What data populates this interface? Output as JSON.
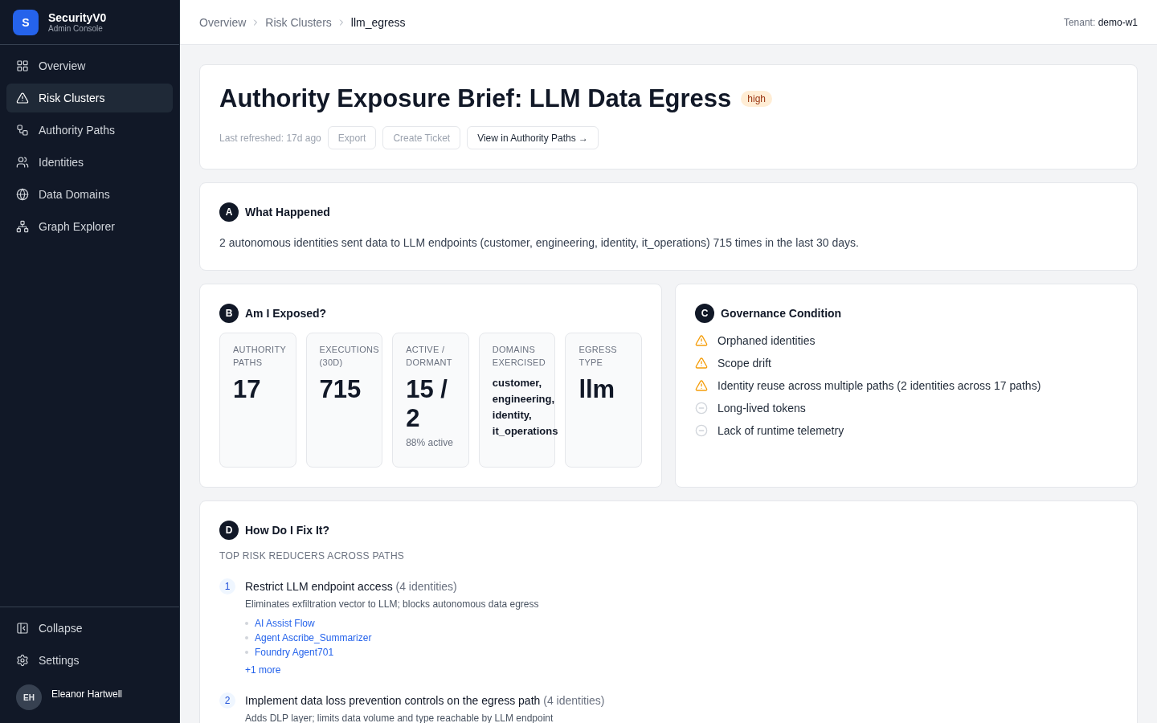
{
  "sidebar": {
    "logo_letter": "S",
    "app_name": "SecurityV0",
    "app_subtitle": "Admin Console",
    "items": [
      {
        "label": "Overview",
        "selected": false
      },
      {
        "label": "Risk Clusters",
        "selected": true
      },
      {
        "label": "Authority Paths",
        "selected": false
      },
      {
        "label": "Identities",
        "selected": false
      },
      {
        "label": "Data Domains",
        "selected": false
      },
      {
        "label": "Graph Explorer",
        "selected": false
      }
    ],
    "footer_items": [
      {
        "label": "Collapse"
      },
      {
        "label": "Settings"
      }
    ],
    "user": {
      "initials": "EH",
      "name": "Eleanor Hartwell"
    }
  },
  "breadcrumbs": [
    {
      "label": "Overview",
      "current": false
    },
    {
      "label": "Risk Clusters",
      "current": false
    },
    {
      "label": "llm_egress",
      "current": true
    }
  ],
  "tenant": {
    "label": "Tenant:",
    "value": "demo-w1"
  },
  "header": {
    "title": "Authority Exposure Brief: LLM Data Egress",
    "severity": "high",
    "last_refreshed": "Last refreshed: 17d ago",
    "buttons": [
      {
        "label": "Export",
        "disabled": true
      },
      {
        "label": "Create Ticket",
        "disabled": true
      },
      {
        "label": "View in Authority Paths →",
        "disabled": false
      }
    ]
  },
  "what_happened": {
    "letter": "A",
    "title": "What Happened",
    "text": "2 autonomous identities sent data to LLM endpoints (customer, engineering, identity, it_operations) 715 times in the last 30 days."
  },
  "exposure": {
    "letter": "B",
    "title": "Am I Exposed?",
    "metrics": [
      {
        "label": "AUTHORITY PATHS",
        "value": "17",
        "kind": "number"
      },
      {
        "label": "EXECUTIONS (30D)",
        "value": "715",
        "kind": "number"
      },
      {
        "label": "ACTIVE / DORMANT",
        "value": "15 / 2",
        "kind": "number",
        "note": "88% active"
      },
      {
        "label": "DOMAINS EXERCISED",
        "value": "customer, engineering, identity, it_operations",
        "kind": "list"
      },
      {
        "label": "EGRESS TYPE",
        "value": "llm",
        "kind": "number"
      }
    ]
  },
  "governance": {
    "letter": "C",
    "title": "Governance Condition",
    "conditions": [
      {
        "text": "Orphaned identities",
        "kind": "warning"
      },
      {
        "text": "Scope drift",
        "kind": "warning"
      },
      {
        "text": "Identity reuse across multiple paths (2 identities across 17 paths)",
        "kind": "warning"
      },
      {
        "text": "Long-lived tokens",
        "kind": "clear"
      },
      {
        "text": "Lack of runtime telemetry",
        "kind": "clear"
      }
    ]
  },
  "fix": {
    "letter": "D",
    "title": "How Do I Fix It?",
    "subtitle": "TOP RISK REDUCERS ACROSS PATHS",
    "reducers": [
      {
        "number": "1",
        "title": "Restrict LLM endpoint access",
        "count": "(4 identities)",
        "description": "Eliminates exfiltration vector to LLM; blocks autonomous data egress",
        "identities": [
          "AI Assist Flow",
          "Agent Ascribe_Summarizer",
          "Foundry Agent701"
        ],
        "more": "+1 more"
      },
      {
        "number": "2",
        "title": "Implement data loss prevention controls on the egress path",
        "count": "(4 identities)",
        "description": "Adds DLP layer; limits data volume and type reachable by LLM endpoint"
      }
    ]
  }
}
